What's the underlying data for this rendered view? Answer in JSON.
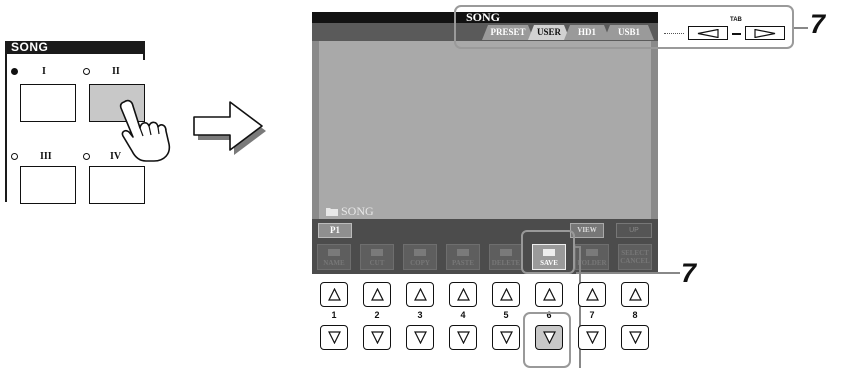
{
  "song_panel": {
    "title": "SONG",
    "buttons": [
      {
        "label": "I",
        "led": "on",
        "pressed": false
      },
      {
        "label": "II",
        "led": "off",
        "pressed": true
      },
      {
        "label": "III",
        "led": "off",
        "pressed": false
      },
      {
        "label": "IV",
        "led": "off",
        "pressed": false
      }
    ]
  },
  "screen": {
    "title": "SONG",
    "tabs": [
      "PRESET",
      "USER",
      "HD1",
      "USB1"
    ],
    "active_tab": "USER",
    "folder": "SONG",
    "page": "P1",
    "view_label": "VIEW",
    "up_label": "UP",
    "functions": [
      "NAME",
      "CUT",
      "COPY",
      "PASTE",
      "DELETE",
      "SAVE",
      "FOLDER",
      "SELECT CANCEL"
    ],
    "function_row2": "",
    "highlighted_function": "SAVE"
  },
  "tab_control": {
    "label": "TAB",
    "left_icon": "triangle-left-icon",
    "right_icon": "triangle-right-icon"
  },
  "step_numbers": [
    "7",
    "7"
  ],
  "physical_buttons": {
    "numbers": [
      "1",
      "2",
      "3",
      "4",
      "5",
      "6",
      "7",
      "8"
    ],
    "up_icon": "triangle-up-icon",
    "down_icon": "triangle-down-icon",
    "pressed_down": "6"
  }
}
